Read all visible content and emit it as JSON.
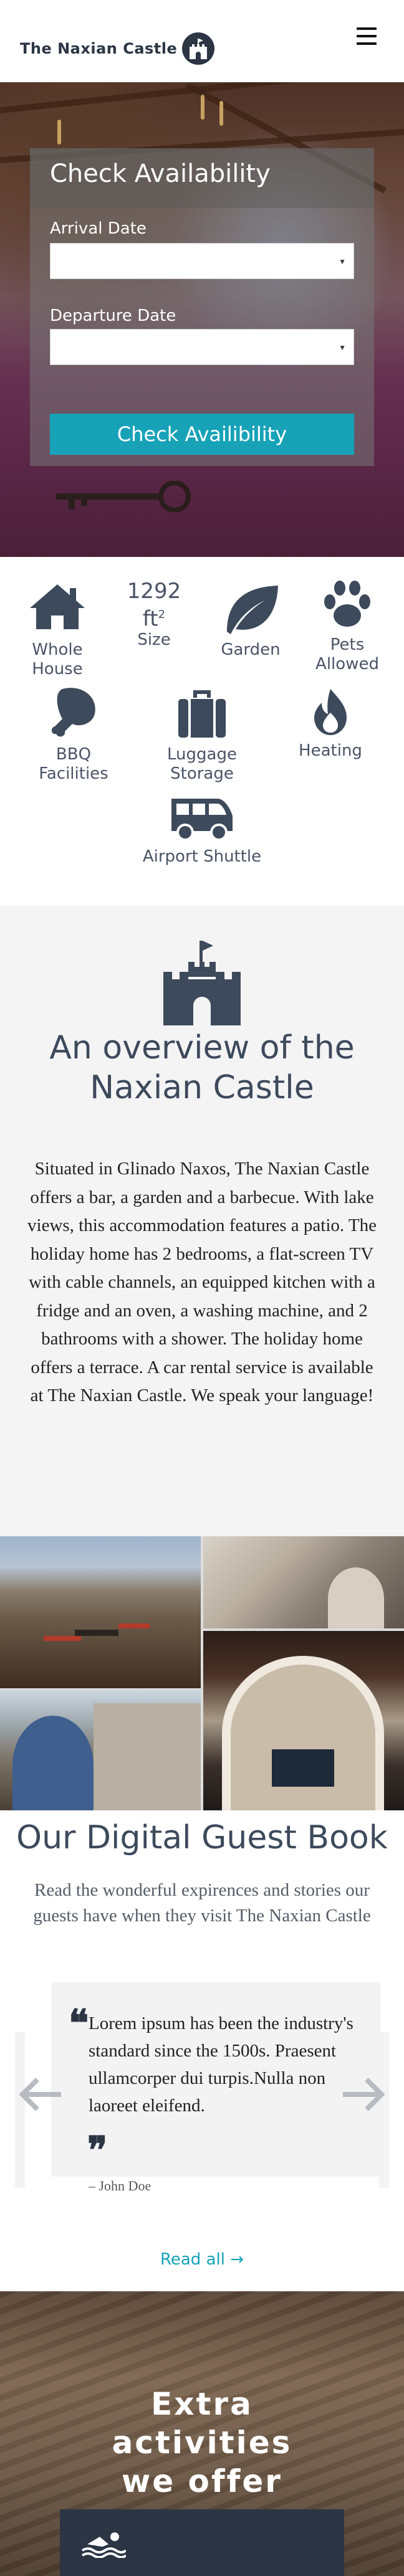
{
  "header": {
    "brand": "The Naxian Castle",
    "logo_icon": "castle-logo-icon",
    "menu_icon": "hamburger-icon"
  },
  "availability": {
    "title": "Check Availability",
    "arrival_label": "Arrival Date",
    "arrival_value": "",
    "departure_label": "Departure Date",
    "departure_value": "",
    "button_label": "Check Availibility",
    "accent": "#17a2b8"
  },
  "amenities": {
    "whole_house": "Whole House",
    "size_value": "1292",
    "size_unit": "ft",
    "size_sup": "2",
    "size_label": "Size",
    "garden": "Garden",
    "pets": "Pets Allowed",
    "bbq": "BBQ Facilities",
    "luggage": "Luggage Storage",
    "heating": "Heating",
    "shuttle": "Airport Shuttle"
  },
  "overview": {
    "title": "An overview of the Naxian Castle",
    "text": "Situated in Glinado Naxos, The Naxian Castle offers a bar, a garden and a barbecue. With lake views, this accommodation features a patio. The holiday home has 2 bedrooms, a flat-screen TV with cable channels, an equipped kitchen with a fridge and an oven, a washing machine, and 2 bathrooms with a shower. The holiday home offers a terrace. A car rental service is available at The Naxian Castle. We speak your language!"
  },
  "guestbook": {
    "title": "Our Digital Guest Book",
    "subtitle": "Read the wonderful expirences and stories our guests have when they visit The Naxian Castle",
    "quote": "Lorem ipsum has been the industry's standard since the 1500s. Praesent ullamcorper dui turpis.Nulla non laoreet eleifend.",
    "author": "– John Doe",
    "read_all": "Read all →"
  },
  "activities": {
    "title": "Extra activities we offer",
    "card_icon": "swimming-icon"
  }
}
